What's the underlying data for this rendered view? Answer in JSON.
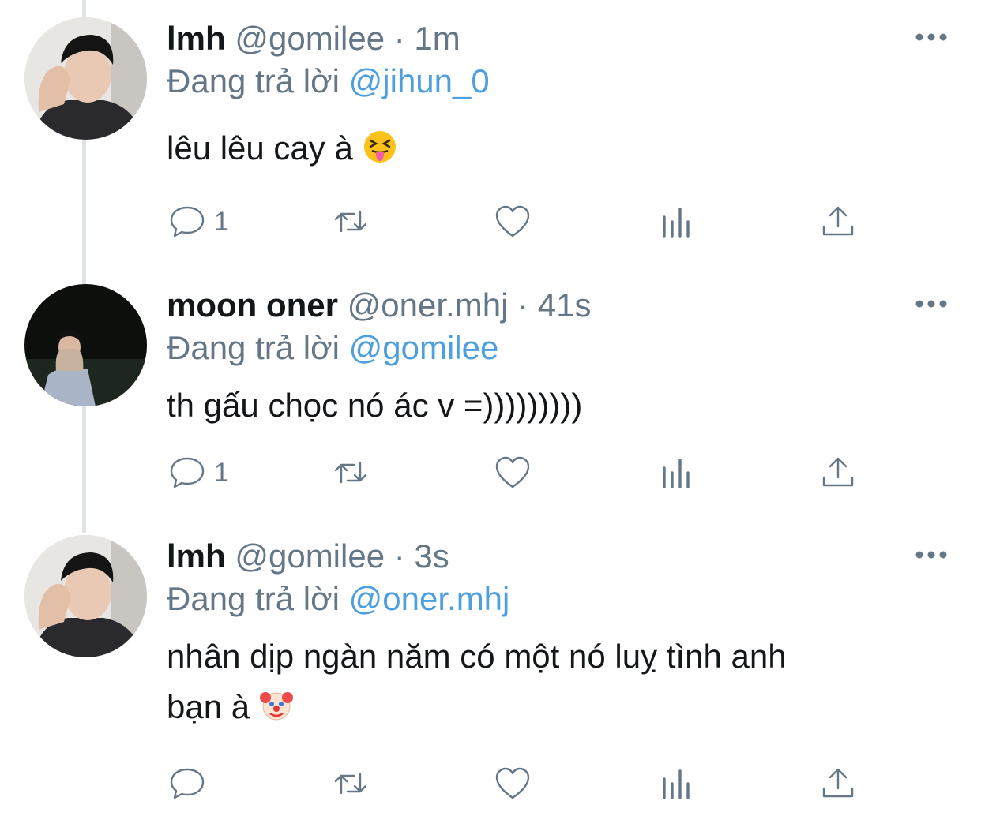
{
  "tweets": [
    {
      "name": "lmh",
      "handle": "@gomilee",
      "separator": "·",
      "time": "1m",
      "reply_prefix": "Đang trả lời",
      "reply_to": "@jihun_0",
      "text": "lêu lêu cay à",
      "emoji": "squinting-tongue-emoji",
      "reply_count": "1"
    },
    {
      "name": "moon oner",
      "handle": "@oner.mhj",
      "separator": "·",
      "time": "41s",
      "reply_prefix": "Đang trả lời",
      "reply_to": "@gomilee",
      "text": "th gấu chọc nó ác v =)))))))))",
      "reply_count": "1"
    },
    {
      "name": "lmh",
      "handle": "@gomilee",
      "separator": "·",
      "time": "3s",
      "reply_prefix": "Đang trả lời",
      "reply_to": "@oner.mhj",
      "text_line1": "nhân dịp ngàn năm có một nó luỵ tình anh",
      "text_line2": "bạn à",
      "emoji": "clown-face-emoji",
      "reply_count": ""
    }
  ],
  "colors": {
    "text": "#14171a",
    "secondary": "#657786",
    "mention": "#4d9fe0",
    "thread_line": "#dfe3e6"
  },
  "icons": [
    "reply-icon",
    "retweet-icon",
    "like-icon",
    "analytics-icon",
    "share-icon",
    "more-icon"
  ]
}
